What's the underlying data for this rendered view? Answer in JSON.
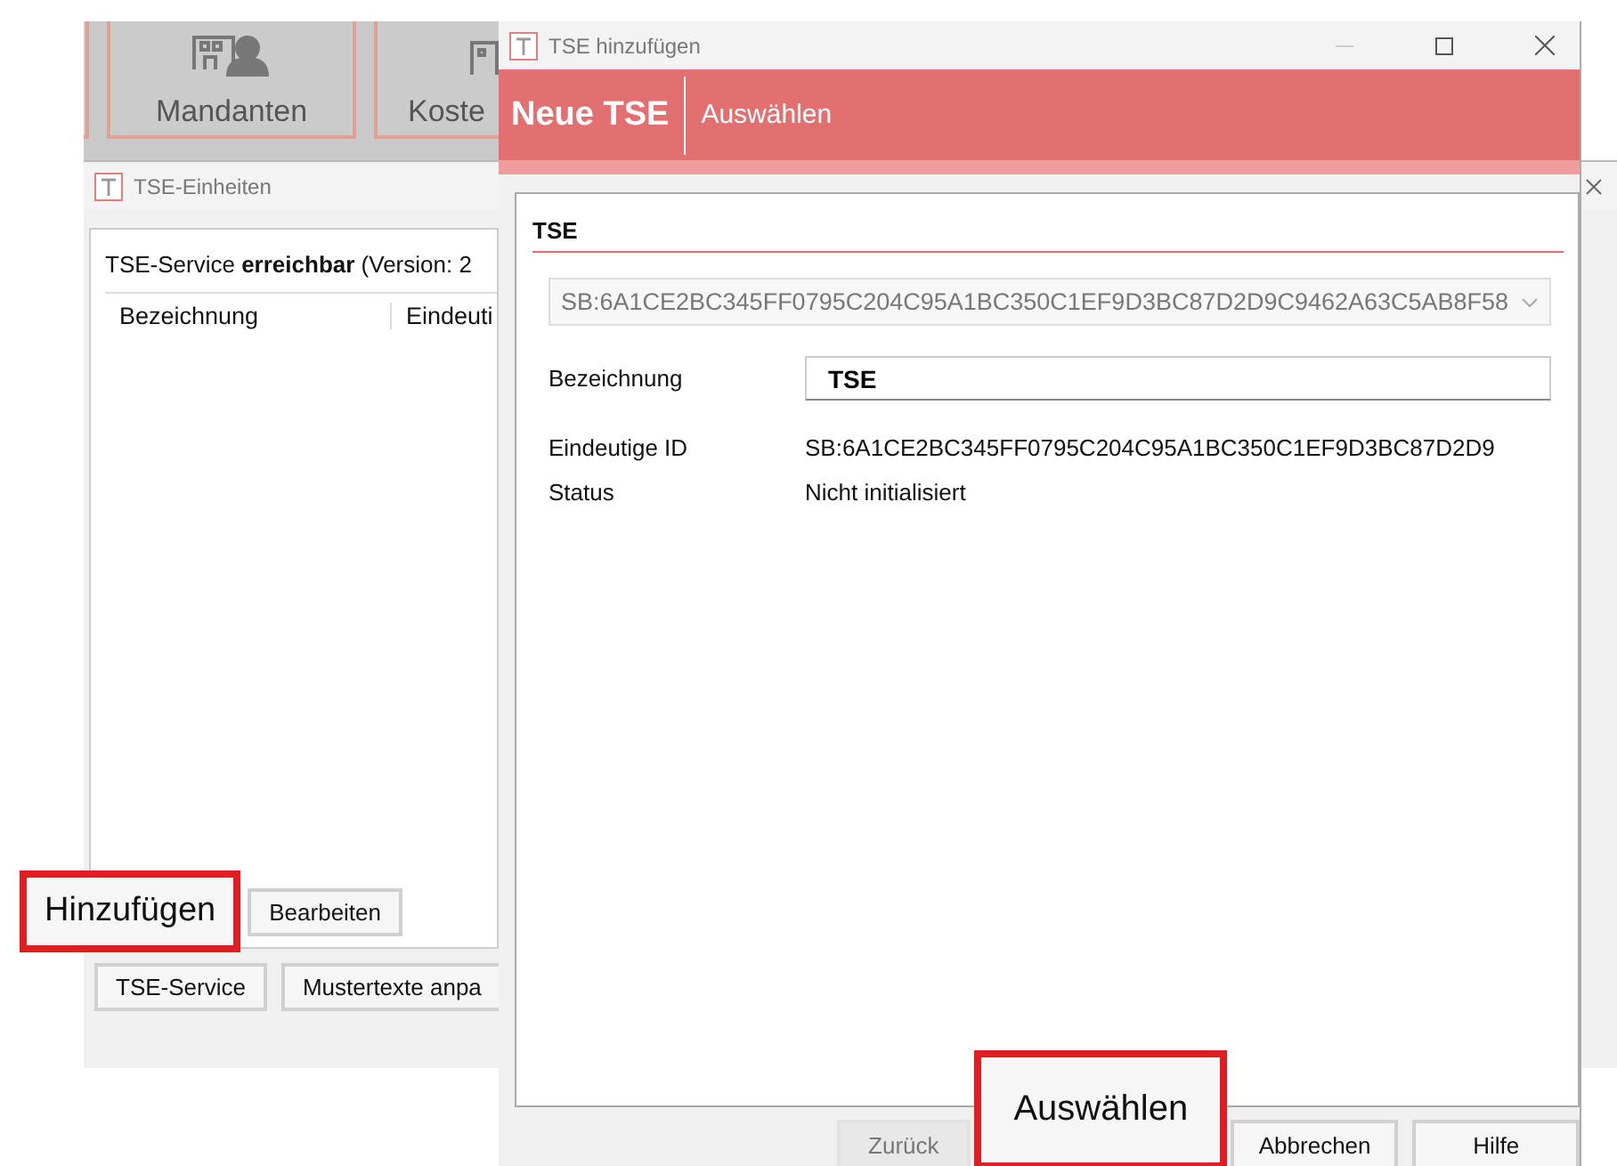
{
  "tiles": [
    {
      "label": "Mandanten"
    },
    {
      "label": "Koste"
    }
  ],
  "tse_window": {
    "title": "TSE-Einheiten",
    "service_status": "TSE-Service **erreichbar** (Version: 2",
    "columns": [
      "Bezeichnung",
      "Eindeuti"
    ],
    "action_buttons": [
      {
        "label": "Hinzufügen",
        "highlighted": true
      },
      {
        "label": "Bearbeiten",
        "highlighted": false
      }
    ],
    "footer_buttons": [
      "TSE-Service",
      "Mustertexte anpa"
    ]
  },
  "dialog": {
    "title": "TSE hinzufügen",
    "banner_title": "Neue TSE",
    "banner_step": "Auswählen",
    "section": "TSE",
    "tse_select": {
      "value": "SB:6A1CE2BC345FF0795C204C95A1BC350C1EF9D3BC87D2D9C9462A63C5AB8F58",
      "disabled": true
    },
    "fields": [
      {
        "kind": "input",
        "label": "Bezeichnung",
        "value": "TSE"
      },
      {
        "kind": "text",
        "label": "Eindeutige ID",
        "value": "SB:6A1CE2BC345FF0795C204C95A1BC350C1EF9D3BC87D2D9"
      },
      {
        "kind": "text",
        "label": "Status",
        "value": "Nicht initialisiert"
      }
    ],
    "buttons": [
      {
        "label": "Zurück",
        "disabled": true,
        "highlighted": false
      },
      {
        "label": "Auswählen",
        "disabled": false,
        "highlighted": true
      },
      {
        "label": "Abbrechen",
        "disabled": false,
        "highlighted": false
      },
      {
        "label": "Hilfe",
        "disabled": false,
        "highlighted": false
      }
    ]
  }
}
